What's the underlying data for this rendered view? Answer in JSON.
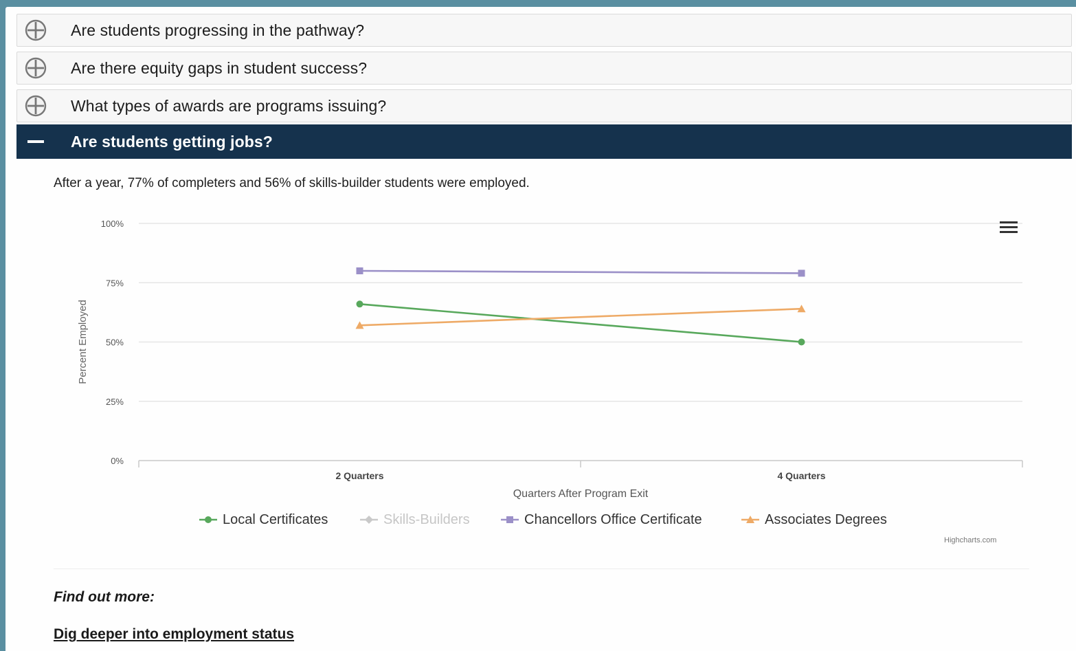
{
  "accordion": [
    {
      "label": "Are students progressing in the pathway?",
      "state": "collapsed"
    },
    {
      "label": "Are there equity gaps in student success?",
      "state": "collapsed"
    },
    {
      "label": "What types of awards are programs issuing?",
      "state": "collapsed"
    },
    {
      "label": "Are students getting jobs?",
      "state": "expanded"
    }
  ],
  "panel": {
    "summary": "After a year, 77% of completers and 56% of skills-builder students were employed.",
    "credit": "Highcharts.com",
    "find_more": "Find out more:",
    "link": "Dig deeper into employment status"
  },
  "colors": {
    "header_dark": "#15324d",
    "local_certificates": "#58a85c",
    "skills_builders": "#c9c9c9",
    "chancellors_office": "#9b90c8",
    "associates_degrees": "#eeaa66"
  },
  "icons": {
    "collapsed": "plus-circle-icon",
    "expanded": "minus-icon",
    "menu": "hamburger-icon"
  },
  "chart_data": {
    "type": "line",
    "title": "",
    "xlabel": "Quarters After Program Exit",
    "ylabel": "Percent Employed",
    "categories": [
      "2 Quarters",
      "4 Quarters"
    ],
    "ylim": [
      0,
      100
    ],
    "yticks": [
      "0%",
      "25%",
      "50%",
      "75%",
      "100%"
    ],
    "grid": true,
    "legend_position": "bottom",
    "series": [
      {
        "name": "Local Certificates",
        "values": [
          66,
          50
        ],
        "color": "#58a85c",
        "marker": "circle",
        "visible": true
      },
      {
        "name": "Skills-Builders",
        "values": [],
        "color": "#c9c9c9",
        "marker": "diamond",
        "visible": false
      },
      {
        "name": "Chancellors Office Certificate",
        "values": [
          80,
          79
        ],
        "color": "#9b90c8",
        "marker": "square",
        "visible": true
      },
      {
        "name": "Associates Degrees",
        "values": [
          57,
          64
        ],
        "color": "#eeaa66",
        "marker": "triangle",
        "visible": true
      }
    ]
  }
}
